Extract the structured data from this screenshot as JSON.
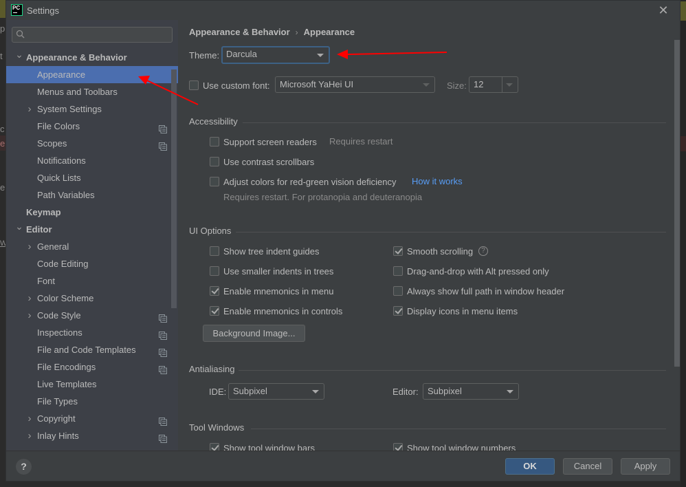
{
  "window": {
    "title": "Settings",
    "app_icon_text": "PC"
  },
  "background_fragments": [
    "p",
    "t",
    "c",
    "e",
    "e",
    "W"
  ],
  "sidebar": {
    "search": {
      "value": "",
      "placeholder": ""
    },
    "items": [
      {
        "label": "Appearance & Behavior",
        "level": 0,
        "expander": "expanded",
        "bold": true,
        "project_icon": false
      },
      {
        "label": "Appearance",
        "level": 1,
        "expander": "none",
        "bold": false,
        "selected": true,
        "project_icon": false
      },
      {
        "label": "Menus and Toolbars",
        "level": 1,
        "expander": "none",
        "bold": false,
        "project_icon": false
      },
      {
        "label": "System Settings",
        "level": 1,
        "expander": "collapsed",
        "bold": false,
        "project_icon": false
      },
      {
        "label": "File Colors",
        "level": 1,
        "expander": "none",
        "bold": false,
        "project_icon": true
      },
      {
        "label": "Scopes",
        "level": 1,
        "expander": "none",
        "bold": false,
        "project_icon": true
      },
      {
        "label": "Notifications",
        "level": 1,
        "expander": "none",
        "bold": false,
        "project_icon": false
      },
      {
        "label": "Quick Lists",
        "level": 1,
        "expander": "none",
        "bold": false,
        "project_icon": false
      },
      {
        "label": "Path Variables",
        "level": 1,
        "expander": "none",
        "bold": false,
        "project_icon": false
      },
      {
        "label": "Keymap",
        "level": 0,
        "expander": "none",
        "bold": true,
        "project_icon": false
      },
      {
        "label": "Editor",
        "level": 0,
        "expander": "expanded",
        "bold": true,
        "project_icon": false
      },
      {
        "label": "General",
        "level": 1,
        "expander": "collapsed",
        "bold": false,
        "project_icon": false
      },
      {
        "label": "Code Editing",
        "level": 1,
        "expander": "none",
        "bold": false,
        "project_icon": false
      },
      {
        "label": "Font",
        "level": 1,
        "expander": "none",
        "bold": false,
        "project_icon": false
      },
      {
        "label": "Color Scheme",
        "level": 1,
        "expander": "collapsed",
        "bold": false,
        "project_icon": false
      },
      {
        "label": "Code Style",
        "level": 1,
        "expander": "collapsed",
        "bold": false,
        "project_icon": true
      },
      {
        "label": "Inspections",
        "level": 1,
        "expander": "none",
        "bold": false,
        "project_icon": true
      },
      {
        "label": "File and Code Templates",
        "level": 1,
        "expander": "none",
        "bold": false,
        "project_icon": true
      },
      {
        "label": "File Encodings",
        "level": 1,
        "expander": "none",
        "bold": false,
        "project_icon": true
      },
      {
        "label": "Live Templates",
        "level": 1,
        "expander": "none",
        "bold": false,
        "project_icon": false
      },
      {
        "label": "File Types",
        "level": 1,
        "expander": "none",
        "bold": false,
        "project_icon": false
      },
      {
        "label": "Copyright",
        "level": 1,
        "expander": "collapsed",
        "bold": false,
        "project_icon": true
      },
      {
        "label": "Inlay Hints",
        "level": 1,
        "expander": "collapsed",
        "bold": false,
        "project_icon": true
      }
    ]
  },
  "breadcrumb": {
    "parent": "Appearance & Behavior",
    "separator": "›",
    "current": "Appearance"
  },
  "theme": {
    "label": "Theme:",
    "value": "Darcula"
  },
  "custom_font": {
    "checkbox_label": "Use custom font:",
    "checked": false,
    "font_value": "Microsoft YaHei UI",
    "size_label": "Size:",
    "size_value": "12"
  },
  "accessibility": {
    "title": "Accessibility",
    "support_screen_readers": {
      "label": "Support screen readers",
      "checked": false,
      "note": "Requires restart"
    },
    "contrast_scrollbars": {
      "label": "Use contrast scrollbars",
      "checked": false
    },
    "red_green": {
      "label": "Adjust colors for red-green vision deficiency",
      "checked": false,
      "link": "How it works",
      "note": "Requires restart. For protanopia and deuteranopia"
    }
  },
  "ui_options": {
    "title": "UI Options",
    "left": [
      {
        "label": "Show tree indent guides",
        "checked": false
      },
      {
        "label": "Use smaller indents in trees",
        "checked": false
      },
      {
        "label": "Enable mnemonics in menu",
        "checked": true
      },
      {
        "label": "Enable mnemonics in controls",
        "checked": true
      }
    ],
    "right": [
      {
        "label": "Smooth scrolling",
        "checked": true,
        "help": "?"
      },
      {
        "label": "Drag-and-drop with Alt pressed only",
        "checked": false
      },
      {
        "label": "Always show full path in window header",
        "checked": false
      },
      {
        "label": "Display icons in menu items",
        "checked": true
      }
    ],
    "background_image_button": "Background Image..."
  },
  "antialiasing": {
    "title": "Antialiasing",
    "ide_label": "IDE:",
    "ide_value": "Subpixel",
    "editor_label": "Editor:",
    "editor_value": "Subpixel"
  },
  "tool_windows": {
    "title": "Tool Windows",
    "left": {
      "label": "Show tool window bars",
      "checked": true
    },
    "right": {
      "label": "Show tool window numbers",
      "checked": true
    }
  },
  "footer": {
    "help": "?",
    "ok": "OK",
    "cancel": "Cancel",
    "apply": "Apply"
  },
  "colors": {
    "dialog_bg": "#3c3f41",
    "sidebar_bg": "#3d4047",
    "selection": "#4b6eaf",
    "link": "#589df6",
    "ok_button": "#365880",
    "annotation_arrow": "#ff0000"
  }
}
